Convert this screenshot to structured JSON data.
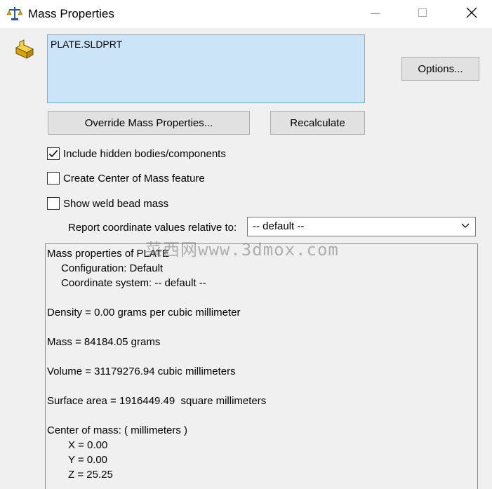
{
  "window": {
    "title": "Mass Properties"
  },
  "selection": {
    "file": "PLATE.SLDPRT"
  },
  "buttons": {
    "options": "Options...",
    "override": "Override Mass Properties...",
    "recalculate": "Recalculate"
  },
  "checkboxes": [
    {
      "label": "Include hidden bodies/components",
      "checked": true
    },
    {
      "label": "Create Center of Mass feature",
      "checked": false
    },
    {
      "label": "Show weld bead mass",
      "checked": false
    }
  ],
  "coordinate": {
    "label": "Report coordinate values relative to:",
    "selected": "-- default --"
  },
  "output": {
    "header": "Mass properties of PLATE",
    "configuration": "Configuration: Default",
    "coordinate_system": "Coordinate system: -- default --",
    "density": "Density = 0.00 grams per cubic millimeter",
    "mass": "Mass = 84184.05 grams",
    "volume": "Volume = 31179276.94 cubic millimeters",
    "surface_area": "Surface area = 1916449.49  square millimeters",
    "center_of_mass": "Center of mass: ( millimeters )",
    "x": "X = 0.00",
    "y": "Y = 0.00",
    "z": "Z = 25.25"
  },
  "watermark": "菜西网www.3dmox.com",
  "icons": [
    "scale-icon",
    "part-icon",
    "minimize-icon",
    "maximize-icon",
    "close-icon",
    "checkmark-icon",
    "chevron-down-icon"
  ]
}
